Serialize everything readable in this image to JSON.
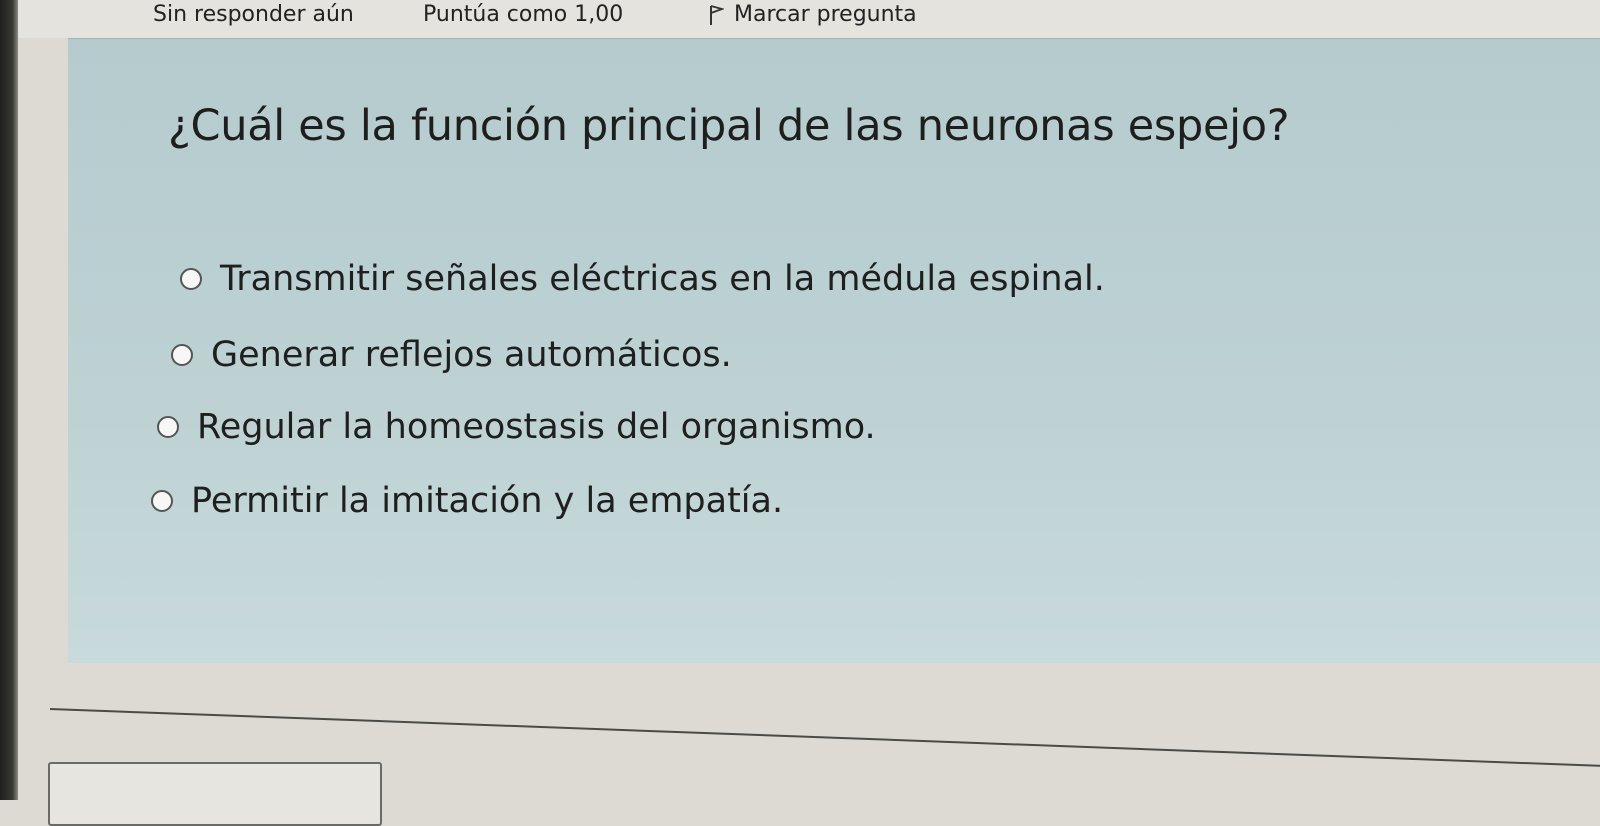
{
  "header": {
    "status": "Sin responder aún",
    "score": "Puntúa como 1,00",
    "flag_label": "Marcar pregunta"
  },
  "question": {
    "text": "¿Cuál es la función principal de las neuronas espejo?"
  },
  "answers": [
    {
      "label": "Transmitir señales eléctricas en la médula espinal.",
      "selected": false
    },
    {
      "label": "Generar reflejos automáticos.",
      "selected": false
    },
    {
      "label": "Regular la homeostasis del organismo.",
      "selected": false
    },
    {
      "label": "Permitir la imitación y la empatía.",
      "selected": false
    }
  ],
  "icons": {
    "flag": "flag-icon",
    "radio": "radio-icon"
  },
  "colors": {
    "panel": "#bed2d4",
    "background": "#dcdad3"
  }
}
